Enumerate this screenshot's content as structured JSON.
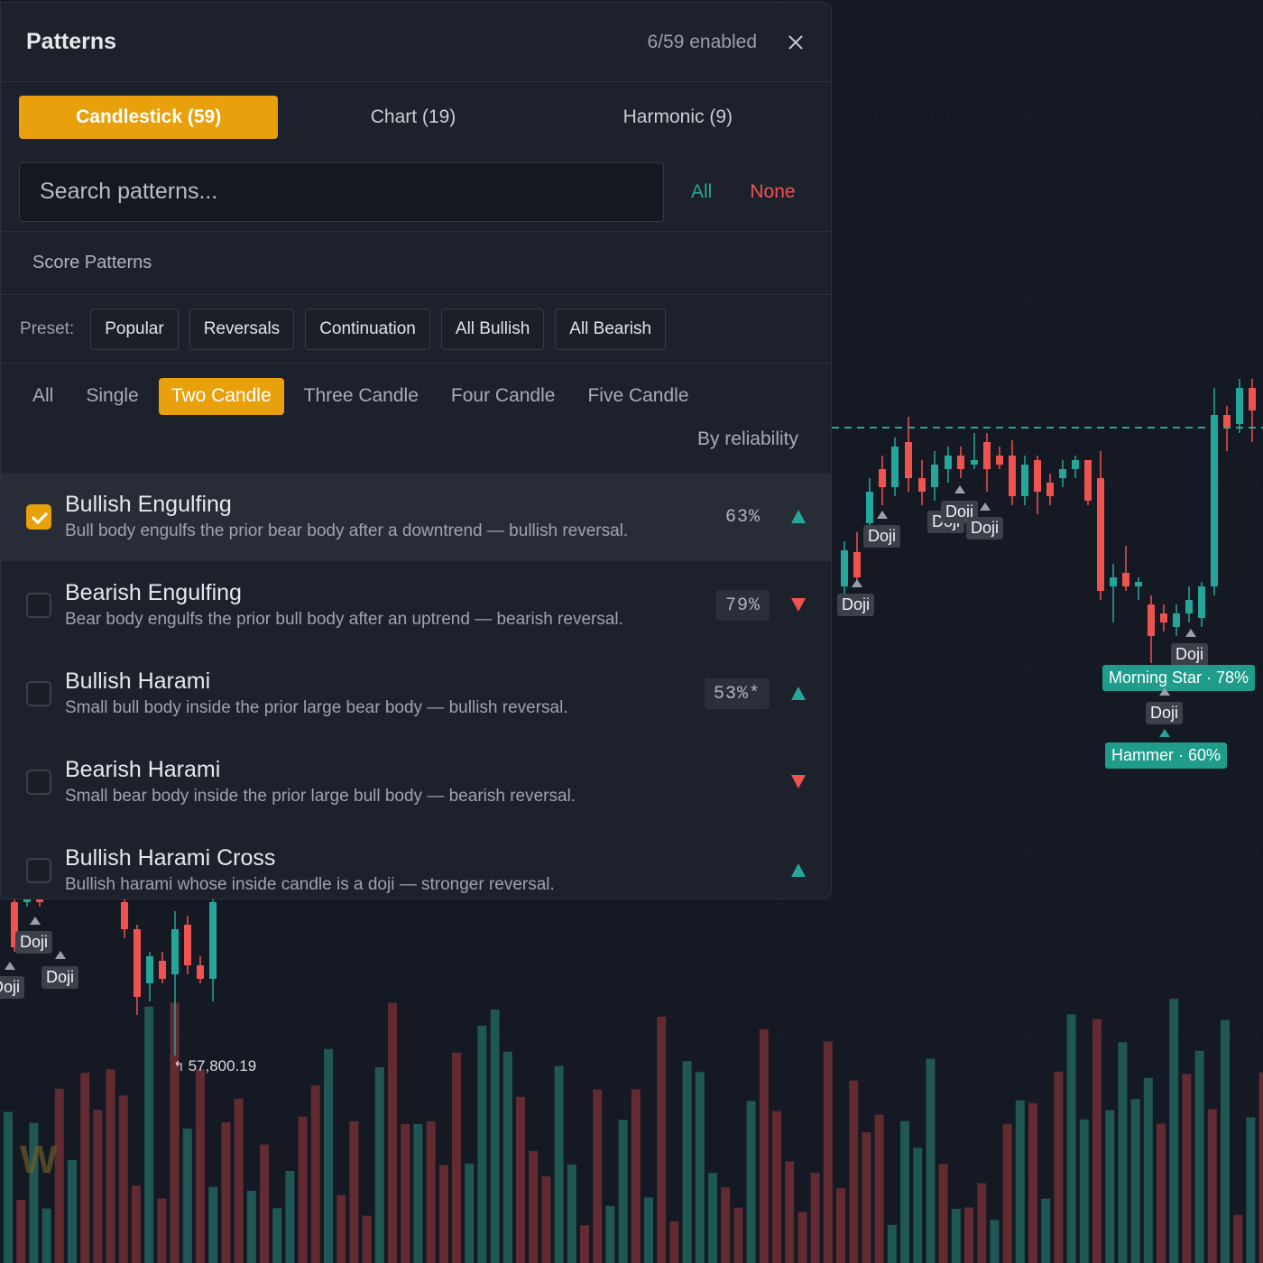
{
  "panel": {
    "title": "Patterns",
    "enabled_count": "6/59 enabled",
    "close_label": "×"
  },
  "category_tabs": [
    {
      "label": "Candlestick (59)",
      "active": true
    },
    {
      "label": "Chart (19)",
      "active": false
    },
    {
      "label": "Harmonic (9)",
      "active": false
    }
  ],
  "search": {
    "placeholder": "Search patterns...",
    "value": "",
    "all_label": "All",
    "none_label": "None"
  },
  "score_patterns_label": "Score Patterns",
  "presets": {
    "label": "Preset:",
    "buttons": [
      "Popular",
      "Reversals",
      "Continuation",
      "All Bullish",
      "All Bearish"
    ]
  },
  "filter_tabs": [
    {
      "label": "All",
      "active": false
    },
    {
      "label": "Single",
      "active": false
    },
    {
      "label": "Two Candle",
      "active": true
    },
    {
      "label": "Three Candle",
      "active": false
    },
    {
      "label": "Four Candle",
      "active": false
    },
    {
      "label": "Five Candle",
      "active": false
    }
  ],
  "sort_label": "By reliability",
  "patterns": [
    {
      "name": "Bullish Engulfing",
      "desc": "Bull body engulfs the prior bear body after a downtrend — bullish reversal.",
      "reliability": "63%",
      "boxed": false,
      "direction": "up",
      "checked": true
    },
    {
      "name": "Bearish Engulfing",
      "desc": "Bear body engulfs the prior bull body after an uptrend — bearish reversal.",
      "reliability": "79%",
      "boxed": true,
      "direction": "down",
      "checked": false
    },
    {
      "name": "Bullish Harami",
      "desc": "Small bull body inside the prior large bear body — bullish reversal.",
      "reliability": "53%*",
      "boxed": true,
      "direction": "up",
      "checked": false
    },
    {
      "name": "Bearish Harami",
      "desc": "Small bear body inside the prior large bull body — bearish reversal.",
      "reliability": "",
      "boxed": false,
      "direction": "down",
      "checked": false
    },
    {
      "name": "Bullish Harami Cross",
      "desc": "Bullish harami whose inside candle is a doji — stronger reversal.",
      "reliability": "",
      "boxed": false,
      "direction": "up",
      "checked": false
    }
  ],
  "chart_annotations": {
    "doji": "Doji",
    "morning_star": "Morning Star · 78%",
    "hammer": "Hammer · 60%",
    "low_price": "57,800.19",
    "logo_letter": "W"
  },
  "colors": {
    "accent": "#e8a00d",
    "bull": "#26a69a",
    "bear": "#ef5350",
    "background": "#151923",
    "panel": "#1d212b"
  }
}
